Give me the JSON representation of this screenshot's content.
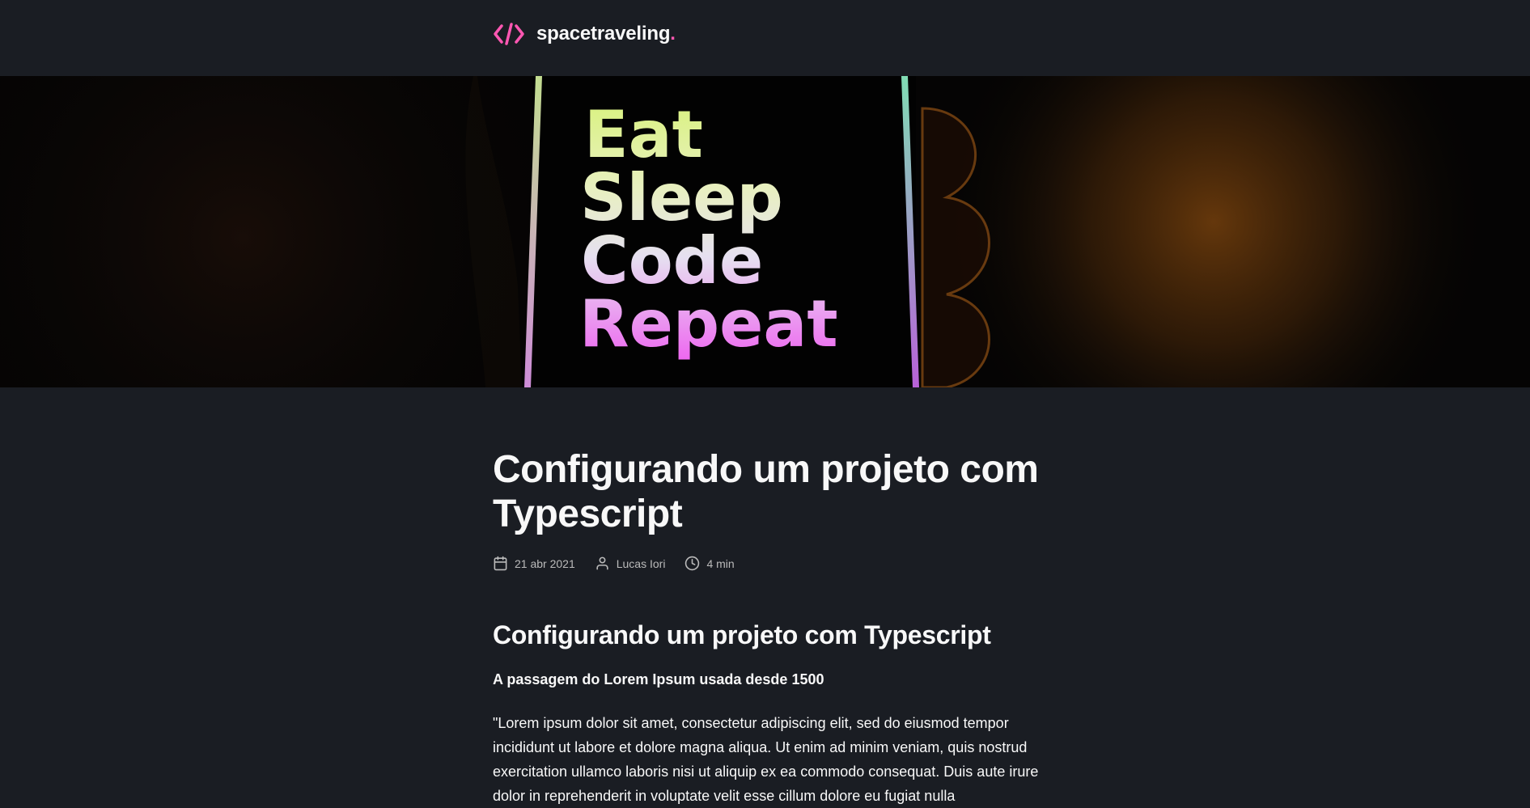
{
  "header": {
    "brand_name": "spacetraveling",
    "brand_dot": ".",
    "logo_icon": "code-brackets-icon"
  },
  "banner": {
    "image_lines": [
      "Eat",
      "Sleep",
      "Code",
      "Repeat"
    ]
  },
  "post": {
    "title": "Configurando um projeto com Typescript",
    "date": "21 abr 2021",
    "author": "Lucas Iori",
    "reading_time": "4 min",
    "section_heading": "Configurando um projeto com Typescript",
    "section_subheading": "A passagem do Lorem Ipsum usada desde 1500",
    "body": "\"Lorem ipsum dolor sit amet, consectetur adipiscing elit, sed do eiusmod tempor incididunt ut labore et dolore magna aliqua. Ut enim ad minim veniam, quis nostrud exercitation ullamco laboris nisi ut aliquip ex ea commodo consequat. Duis aute irure dolor in reprehenderit in voluptate velit esse cillum dolore eu fugiat nulla"
  },
  "colors": {
    "accent": "#ff57b2",
    "background": "#1a1d23",
    "text": "#f8f8f8",
    "meta_text": "#bbbbbb"
  }
}
